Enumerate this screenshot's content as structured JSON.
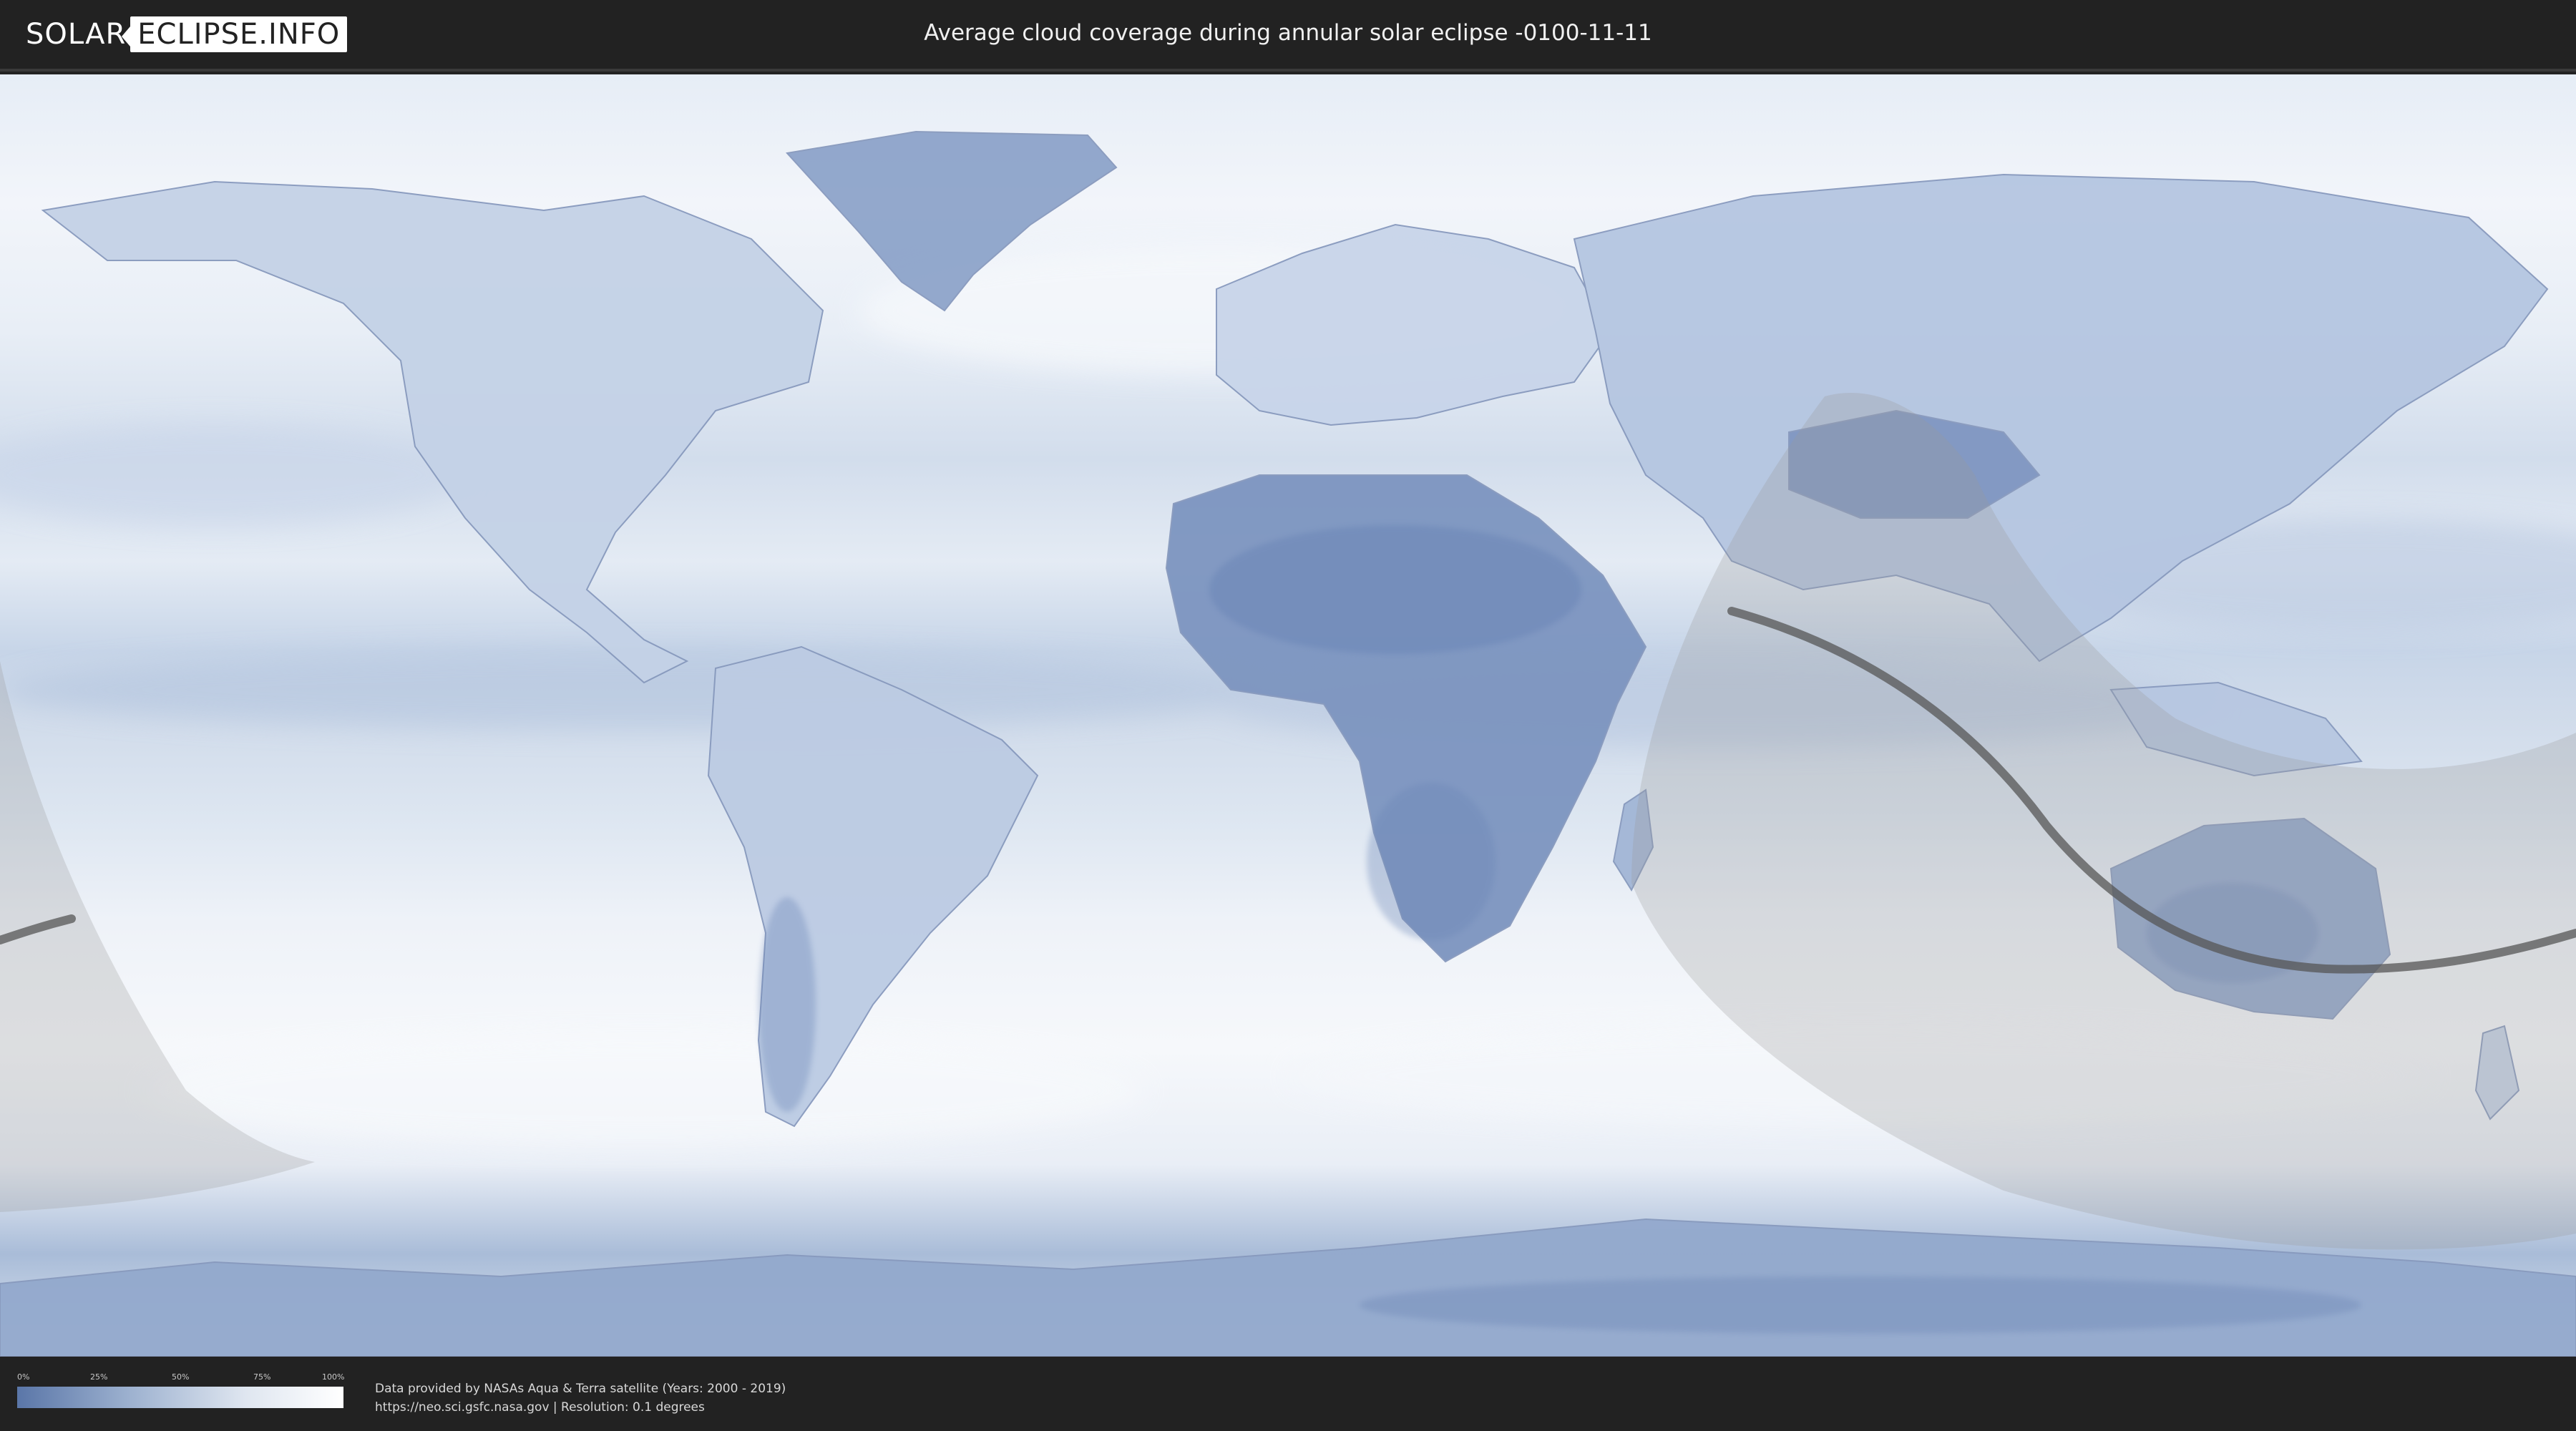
{
  "header": {
    "logo_left": "SOLAR",
    "logo_right": "ECLIPSE.INFO",
    "title": "Average cloud coverage during annular solar eclipse -0100-11-11"
  },
  "legend": {
    "ticks": [
      "0%",
      "25%",
      "50%",
      "75%",
      "100%"
    ],
    "color_low": "#5a76a8",
    "color_high": "#ffffff"
  },
  "credits": {
    "line1": "Data provided by NASAs Aqua & Terra satellite (Years: 2000 - 2019)",
    "line2": "https://neo.sci.gsfc.nasa.gov | Resolution: 0.1 degrees"
  },
  "colors": {
    "background": "#222222",
    "ocean_clear": "#c3d2e6",
    "cloud_heavy": "#f4f6fa",
    "land_clear": "#6f88b6",
    "eclipse_shadow": "#9a9a9a",
    "central_line": "#555555"
  }
}
